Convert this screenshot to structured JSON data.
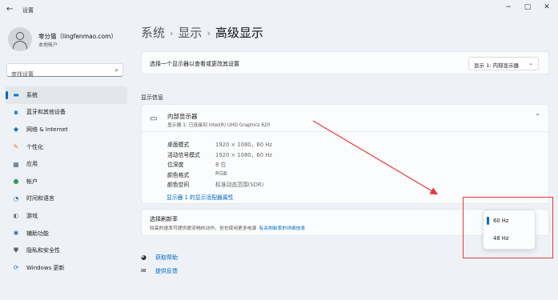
{
  "window": {
    "title": "设置",
    "back_icon": "←",
    "minimize_icon": "−",
    "maximize_icon": "▢",
    "close_icon": "✕"
  },
  "profile": {
    "name": "零分猫（lingfenmao.com）",
    "account_type": "本地帐户"
  },
  "search": {
    "placeholder": "查找设置",
    "icon": "⌕"
  },
  "sidebar": {
    "items": [
      {
        "label": "系统",
        "icon": "▬",
        "color": "#0078d4",
        "active": true
      },
      {
        "label": "蓝牙和其他设备",
        "icon": "ʙ",
        "color": "#0067c0"
      },
      {
        "label": "网络 & Internet",
        "icon": "◆",
        "color": "#1a6fc4"
      },
      {
        "label": "个性化",
        "icon": "✎",
        "color": "#d9822b"
      },
      {
        "label": "应用",
        "icon": "▦",
        "color": "#4a5a72"
      },
      {
        "label": "帐户",
        "icon": "●",
        "color": "#2e9d5b"
      },
      {
        "label": "时间和语言",
        "icon": "◔",
        "color": "#1a7fc4"
      },
      {
        "label": "游戏",
        "icon": "◐",
        "color": "#6b7785"
      },
      {
        "label": "辅助功能",
        "icon": "✱",
        "color": "#1a6fc4"
      },
      {
        "label": "隐私和安全性",
        "icon": "⛊",
        "color": "#5b6775"
      },
      {
        "label": "Windows 更新",
        "icon": "⟳",
        "color": "#1a73c9"
      }
    ]
  },
  "breadcrumb": {
    "items": [
      "系统",
      "显示"
    ],
    "separator": "›",
    "current": "高级显示"
  },
  "display_selector": {
    "label": "选择一个显示器以查看或更改其设置",
    "value": "显示 1: 内部显示器",
    "chevron": "⌄"
  },
  "display_info": {
    "section_title": "显示信息",
    "display_name": "内部显示器",
    "display_subtitle": "显示器 1: 已连接到 Intel(R) UHD Graphics 620",
    "collapse_icon": "⌃",
    "properties": [
      {
        "name": "桌面模式",
        "value": "1920 × 1080，60 Hz"
      },
      {
        "name": "活动信号模式",
        "value": "1920 × 1080，60 Hz"
      },
      {
        "name": "位深度",
        "value": "8 位"
      },
      {
        "name": "颜色格式",
        "value": "RGB"
      },
      {
        "name": "颜色空间",
        "value": "标准动态范围(SDR)"
      }
    ],
    "adapter_link": "显示器 1 的显示适配器属性"
  },
  "refresh_rate": {
    "title": "选择刷新率",
    "description": "较高的速率可提供更流畅的动作，但也使用更多电源",
    "link": "有关刷新率的详细信息",
    "options": [
      "60 Hz",
      "48 Hz"
    ],
    "selected": "60 Hz"
  },
  "help": {
    "get_help": "获取帮助",
    "feedback": "提供反馈"
  },
  "colors": {
    "accent": "#0067c0",
    "annotation": "#e53935"
  }
}
